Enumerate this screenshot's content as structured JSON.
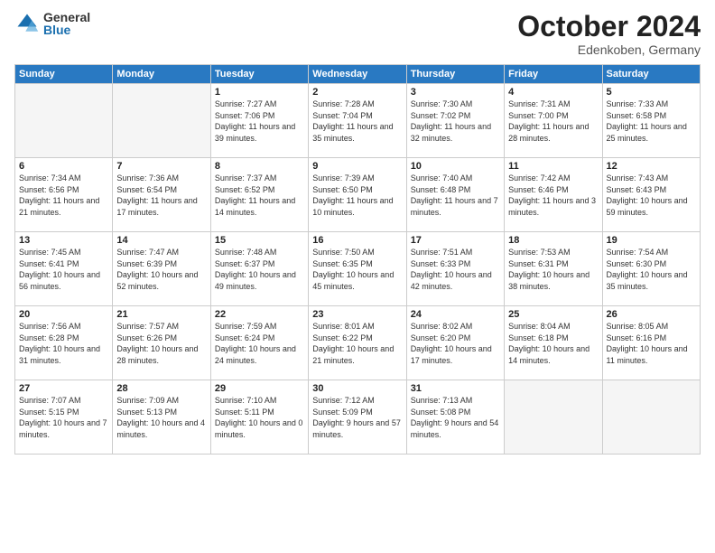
{
  "header": {
    "logo_general": "General",
    "logo_blue": "Blue",
    "month_title": "October 2024",
    "location": "Edenkoben, Germany"
  },
  "days_of_week": [
    "Sunday",
    "Monday",
    "Tuesday",
    "Wednesday",
    "Thursday",
    "Friday",
    "Saturday"
  ],
  "weeks": [
    [
      {
        "day": "",
        "info": ""
      },
      {
        "day": "",
        "info": ""
      },
      {
        "day": "1",
        "info": "Sunrise: 7:27 AM\nSunset: 7:06 PM\nDaylight: 11 hours and 39 minutes."
      },
      {
        "day": "2",
        "info": "Sunrise: 7:28 AM\nSunset: 7:04 PM\nDaylight: 11 hours and 35 minutes."
      },
      {
        "day": "3",
        "info": "Sunrise: 7:30 AM\nSunset: 7:02 PM\nDaylight: 11 hours and 32 minutes."
      },
      {
        "day": "4",
        "info": "Sunrise: 7:31 AM\nSunset: 7:00 PM\nDaylight: 11 hours and 28 minutes."
      },
      {
        "day": "5",
        "info": "Sunrise: 7:33 AM\nSunset: 6:58 PM\nDaylight: 11 hours and 25 minutes."
      }
    ],
    [
      {
        "day": "6",
        "info": "Sunrise: 7:34 AM\nSunset: 6:56 PM\nDaylight: 11 hours and 21 minutes."
      },
      {
        "day": "7",
        "info": "Sunrise: 7:36 AM\nSunset: 6:54 PM\nDaylight: 11 hours and 17 minutes."
      },
      {
        "day": "8",
        "info": "Sunrise: 7:37 AM\nSunset: 6:52 PM\nDaylight: 11 hours and 14 minutes."
      },
      {
        "day": "9",
        "info": "Sunrise: 7:39 AM\nSunset: 6:50 PM\nDaylight: 11 hours and 10 minutes."
      },
      {
        "day": "10",
        "info": "Sunrise: 7:40 AM\nSunset: 6:48 PM\nDaylight: 11 hours and 7 minutes."
      },
      {
        "day": "11",
        "info": "Sunrise: 7:42 AM\nSunset: 6:46 PM\nDaylight: 11 hours and 3 minutes."
      },
      {
        "day": "12",
        "info": "Sunrise: 7:43 AM\nSunset: 6:43 PM\nDaylight: 10 hours and 59 minutes."
      }
    ],
    [
      {
        "day": "13",
        "info": "Sunrise: 7:45 AM\nSunset: 6:41 PM\nDaylight: 10 hours and 56 minutes."
      },
      {
        "day": "14",
        "info": "Sunrise: 7:47 AM\nSunset: 6:39 PM\nDaylight: 10 hours and 52 minutes."
      },
      {
        "day": "15",
        "info": "Sunrise: 7:48 AM\nSunset: 6:37 PM\nDaylight: 10 hours and 49 minutes."
      },
      {
        "day": "16",
        "info": "Sunrise: 7:50 AM\nSunset: 6:35 PM\nDaylight: 10 hours and 45 minutes."
      },
      {
        "day": "17",
        "info": "Sunrise: 7:51 AM\nSunset: 6:33 PM\nDaylight: 10 hours and 42 minutes."
      },
      {
        "day": "18",
        "info": "Sunrise: 7:53 AM\nSunset: 6:31 PM\nDaylight: 10 hours and 38 minutes."
      },
      {
        "day": "19",
        "info": "Sunrise: 7:54 AM\nSunset: 6:30 PM\nDaylight: 10 hours and 35 minutes."
      }
    ],
    [
      {
        "day": "20",
        "info": "Sunrise: 7:56 AM\nSunset: 6:28 PM\nDaylight: 10 hours and 31 minutes."
      },
      {
        "day": "21",
        "info": "Sunrise: 7:57 AM\nSunset: 6:26 PM\nDaylight: 10 hours and 28 minutes."
      },
      {
        "day": "22",
        "info": "Sunrise: 7:59 AM\nSunset: 6:24 PM\nDaylight: 10 hours and 24 minutes."
      },
      {
        "day": "23",
        "info": "Sunrise: 8:01 AM\nSunset: 6:22 PM\nDaylight: 10 hours and 21 minutes."
      },
      {
        "day": "24",
        "info": "Sunrise: 8:02 AM\nSunset: 6:20 PM\nDaylight: 10 hours and 17 minutes."
      },
      {
        "day": "25",
        "info": "Sunrise: 8:04 AM\nSunset: 6:18 PM\nDaylight: 10 hours and 14 minutes."
      },
      {
        "day": "26",
        "info": "Sunrise: 8:05 AM\nSunset: 6:16 PM\nDaylight: 10 hours and 11 minutes."
      }
    ],
    [
      {
        "day": "27",
        "info": "Sunrise: 7:07 AM\nSunset: 5:15 PM\nDaylight: 10 hours and 7 minutes."
      },
      {
        "day": "28",
        "info": "Sunrise: 7:09 AM\nSunset: 5:13 PM\nDaylight: 10 hours and 4 minutes."
      },
      {
        "day": "29",
        "info": "Sunrise: 7:10 AM\nSunset: 5:11 PM\nDaylight: 10 hours and 0 minutes."
      },
      {
        "day": "30",
        "info": "Sunrise: 7:12 AM\nSunset: 5:09 PM\nDaylight: 9 hours and 57 minutes."
      },
      {
        "day": "31",
        "info": "Sunrise: 7:13 AM\nSunset: 5:08 PM\nDaylight: 9 hours and 54 minutes."
      },
      {
        "day": "",
        "info": ""
      },
      {
        "day": "",
        "info": ""
      }
    ]
  ]
}
